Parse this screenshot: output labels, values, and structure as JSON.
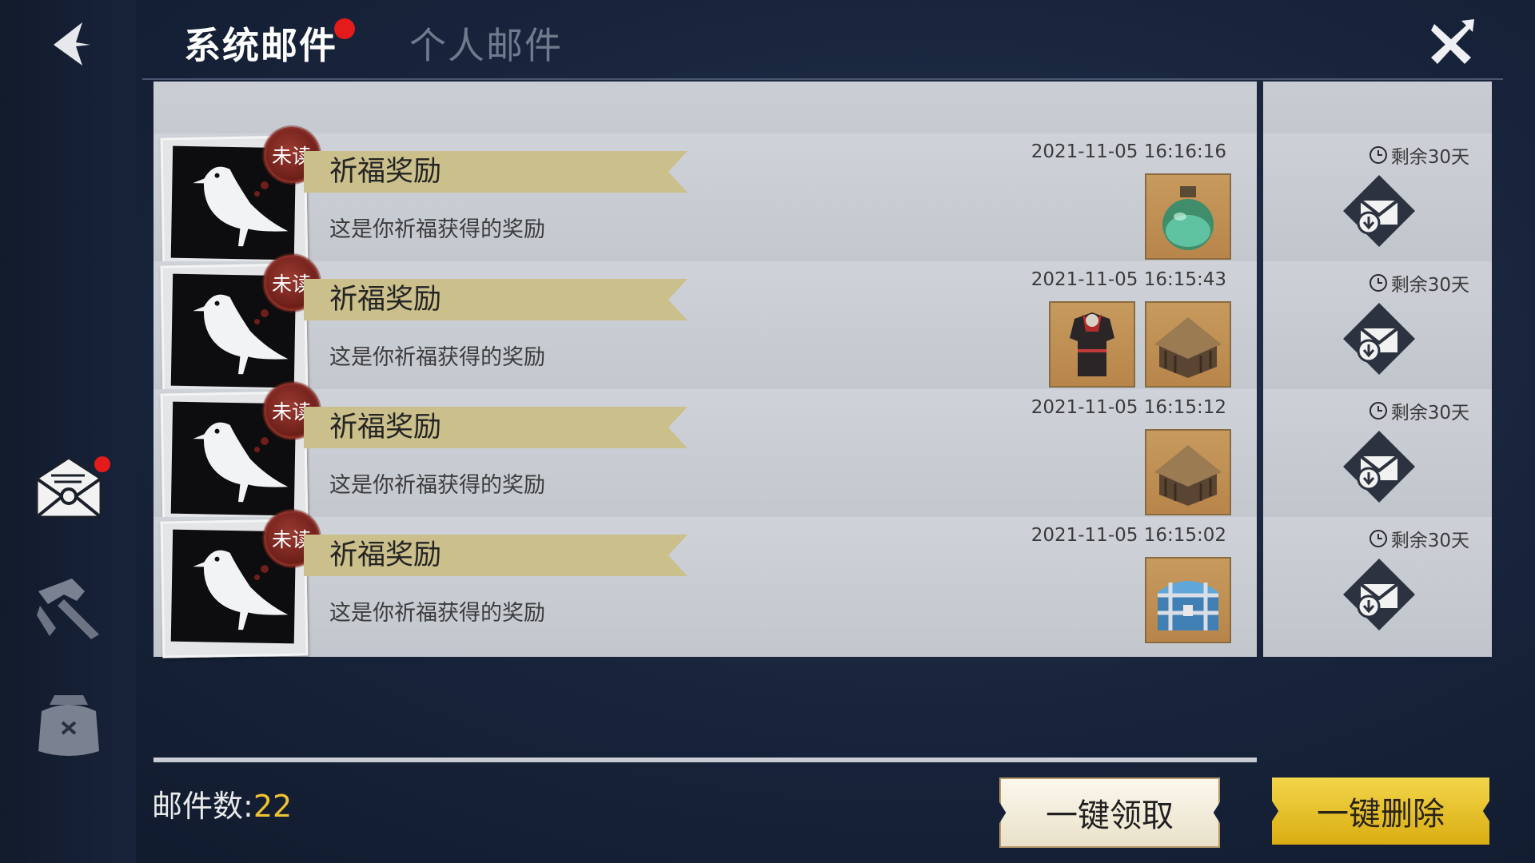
{
  "tabs": {
    "system": "系统邮件",
    "personal": "个人邮件"
  },
  "mails": [
    {
      "seal": "未读",
      "title": "祈福奖励",
      "desc": "这是你祈福获得的奖励",
      "time": "2021-11-05 16:16:16",
      "remain": "剩余30天",
      "items": [
        "green-potion-icon"
      ]
    },
    {
      "seal": "未读",
      "title": "祈福奖励",
      "desc": "这是你祈福获得的奖励",
      "time": "2021-11-05 16:15:43",
      "remain": "剩余30天",
      "items": [
        "armor-icon",
        "hut-icon"
      ]
    },
    {
      "seal": "未读",
      "title": "祈福奖励",
      "desc": "这是你祈福获得的奖励",
      "time": "2021-11-05 16:15:12",
      "remain": "剩余30天",
      "items": [
        "hut-icon"
      ]
    },
    {
      "seal": "未读",
      "title": "祈福奖励",
      "desc": "这是你祈福获得的奖励",
      "time": "2021-11-05 16:15:02",
      "remain": "剩余30天",
      "items": [
        "chest-icon"
      ]
    }
  ],
  "footer": {
    "count_label": "邮件数:",
    "count": "22",
    "claim_all": "一键领取",
    "delete_all": "一键删除"
  },
  "colors": {
    "accent_yellow": "#f0c232",
    "unread_seal": "#6e1f1a",
    "notification_dot": "#e41b1b"
  }
}
